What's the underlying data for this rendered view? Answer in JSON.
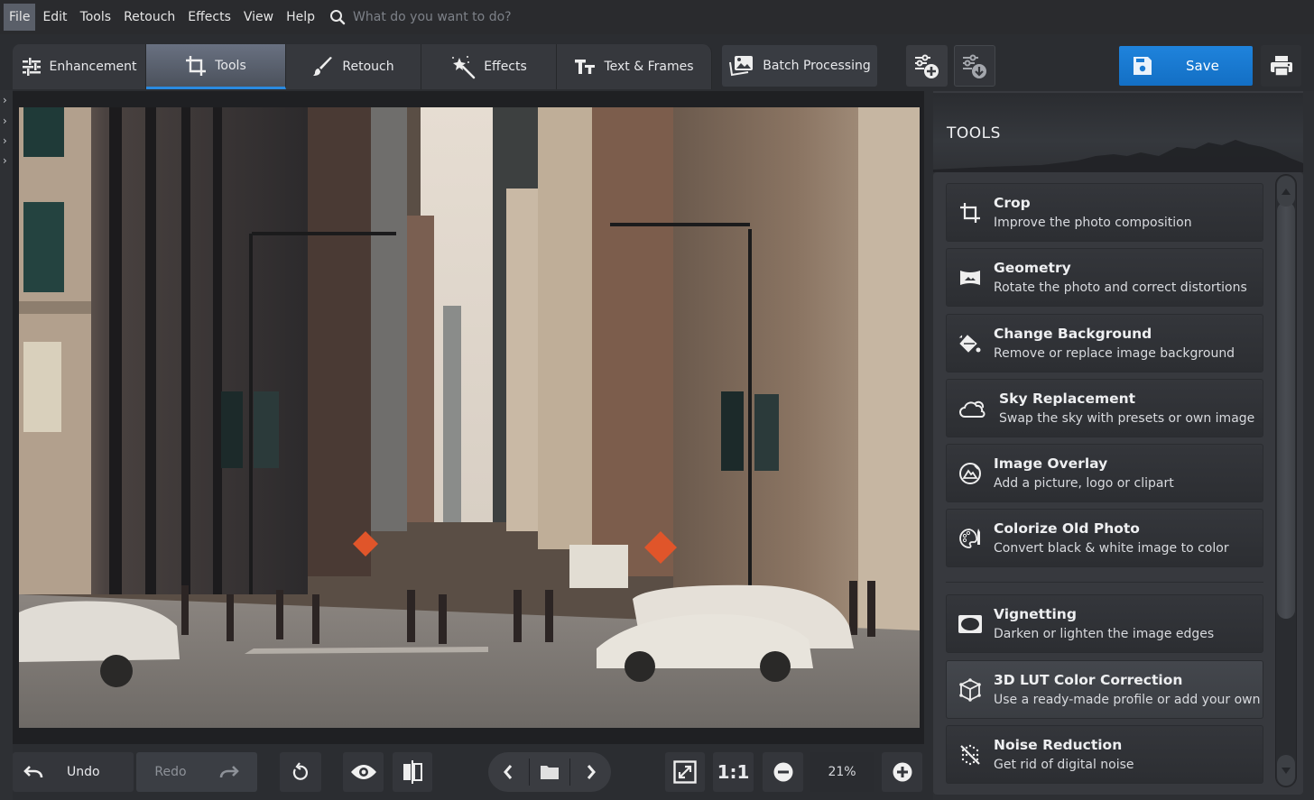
{
  "menubar": {
    "items": [
      "File",
      "Edit",
      "Tools",
      "Retouch",
      "Effects",
      "View",
      "Help"
    ],
    "active": "File",
    "search_placeholder": "What do you want to do?"
  },
  "tabs": [
    {
      "label": "Enhancement",
      "icon": "sliders-icon",
      "active": false
    },
    {
      "label": "Tools",
      "icon": "crop-icon",
      "active": true
    },
    {
      "label": "Retouch",
      "icon": "brush-icon",
      "active": false
    },
    {
      "label": "Effects",
      "icon": "magic-wand-icon",
      "active": false
    },
    {
      "label": "Text & Frames",
      "icon": "text-icon",
      "active": false
    }
  ],
  "toolbar": {
    "batch_label": "Batch Processing",
    "add_preset_icon": "add-preset-icon",
    "load_preset_icon": "download-preset-icon",
    "save_label": "Save",
    "print_icon": "printer-icon",
    "accent_color": "#1a7ad2"
  },
  "right_panel": {
    "title": "TOOLS",
    "tools": [
      {
        "name": "Crop",
        "desc": "Improve the photo composition",
        "icon": "crop-icon"
      },
      {
        "name": "Geometry",
        "desc": "Rotate the photo and correct distortions",
        "icon": "geometry-icon"
      },
      {
        "name": "Change Background",
        "desc": "Remove or replace image background",
        "icon": "paint-bucket-icon"
      },
      {
        "name": "Sky Replacement",
        "desc": "Swap the sky with presets or own image",
        "icon": "cloud-icon"
      },
      {
        "name": "Image Overlay",
        "desc": "Add a picture, logo or clipart",
        "icon": "image-overlay-icon"
      },
      {
        "name": "Colorize Old Photo",
        "desc": "Convert black & white image to color",
        "icon": "palette-icon"
      },
      {
        "name": "Vignetting",
        "desc": "Darken or lighten the image edges",
        "icon": "vignette-icon"
      },
      {
        "name": "3D LUT Color Correction",
        "desc": "Use a ready-made profile or add your own",
        "icon": "cube-icon"
      },
      {
        "name": "Noise Reduction",
        "desc": "Get rid of digital noise",
        "icon": "noise-icon"
      }
    ]
  },
  "bottom_toolbar": {
    "undo_label": "Undo",
    "redo_label": "Redo",
    "actual_size_label": "1:1",
    "zoom_value": "21%"
  },
  "photo": {
    "description": "City street with tall buildings, pedestrians and white cars"
  }
}
